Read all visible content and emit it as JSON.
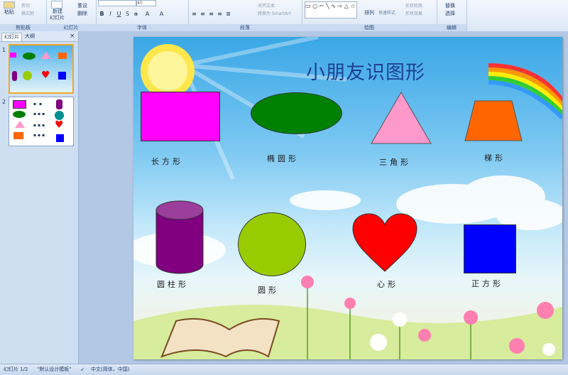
{
  "ribbon": {
    "clipboard": {
      "paste": "粘贴",
      "cut": "剪切",
      "format_painter": "格式刷",
      "group": "剪贴板"
    },
    "slides": {
      "new_slide": "新建",
      "new_slide2": "幻灯片",
      "reset": "重设",
      "delete": "删除",
      "group": "幻灯片"
    },
    "font": {
      "size": "40",
      "group": "字体"
    },
    "paragraph": {
      "align_text": "对齐文本",
      "smartart": "转换为 SmartArt",
      "group": "段落"
    },
    "drawing": {
      "arrange": "排列",
      "quick_styles": "快速样式",
      "shape_outline": "形状轮廓",
      "shape_effects": "形状效果",
      "group": "绘图"
    },
    "editing": {
      "replace": "替换",
      "select": "选择",
      "group": "编辑"
    }
  },
  "panel": {
    "tab_slides": "幻灯片",
    "tab_outline": "大纲",
    "close": "×",
    "thumbs": [
      "1",
      "2"
    ]
  },
  "slide": {
    "title": "小朋友识图形",
    "labels": {
      "rectangle": "长方形",
      "ellipse": "椭圆形",
      "triangle": "三角形",
      "trapezoid": "梯形",
      "cylinder": "圆柱形",
      "circle": "圆形",
      "heart": "心形",
      "square": "正方形"
    },
    "colors": {
      "rectangle": "#ff00ff",
      "ellipse": "#008000",
      "triangle": "#ff99cc",
      "trapezoid": "#ff6600",
      "cylinder": "#800080",
      "circle": "#99cc00",
      "heart": "#ff0000",
      "square": "#0000ff"
    }
  },
  "status": {
    "slide_pos": "幻灯片 1/2",
    "theme": "\"默认设计模板\"",
    "language": "中文(简体，中国)"
  }
}
